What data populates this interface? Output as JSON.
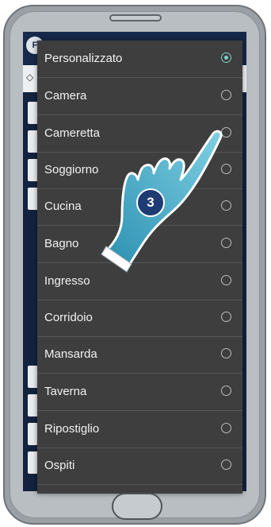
{
  "app": {
    "logo_text": "F"
  },
  "dialog": {
    "options": [
      {
        "label": "Personalizzato",
        "selected": true
      },
      {
        "label": "Camera",
        "selected": false
      },
      {
        "label": "Cameretta",
        "selected": false
      },
      {
        "label": "Soggiorno",
        "selected": false
      },
      {
        "label": "Cucina",
        "selected": false
      },
      {
        "label": "Bagno",
        "selected": false
      },
      {
        "label": "Ingresso",
        "selected": false
      },
      {
        "label": "Corridoio",
        "selected": false
      },
      {
        "label": "Mansarda",
        "selected": false
      },
      {
        "label": "Taverna",
        "selected": false
      },
      {
        "label": "Ripostiglio",
        "selected": false
      },
      {
        "label": "Ospiti",
        "selected": false
      }
    ]
  },
  "hint": {
    "step_number": "3"
  },
  "colors": {
    "accent": "#7ed3c3",
    "dialog_bg": "#3e3e3e",
    "app_bar": "#17294a",
    "hand": "#3aa8c4",
    "step_badge": "#1f3b73"
  }
}
